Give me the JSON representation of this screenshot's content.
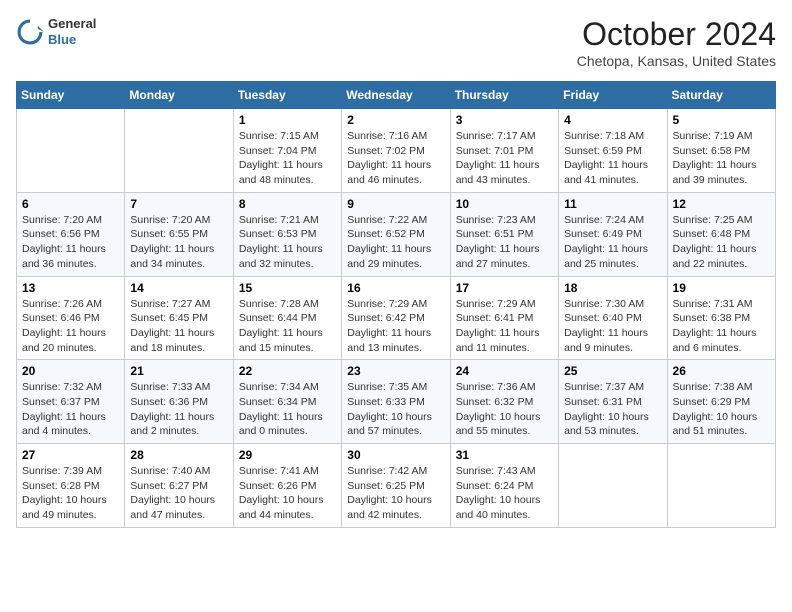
{
  "header": {
    "logo_line1": "General",
    "logo_line2": "Blue",
    "month_title": "October 2024",
    "location": "Chetopa, Kansas, United States"
  },
  "weekdays": [
    "Sunday",
    "Monday",
    "Tuesday",
    "Wednesday",
    "Thursday",
    "Friday",
    "Saturday"
  ],
  "weeks": [
    [
      {
        "day": "",
        "info": ""
      },
      {
        "day": "",
        "info": ""
      },
      {
        "day": "1",
        "info": "Sunrise: 7:15 AM\nSunset: 7:04 PM\nDaylight: 11 hours and 48 minutes."
      },
      {
        "day": "2",
        "info": "Sunrise: 7:16 AM\nSunset: 7:02 PM\nDaylight: 11 hours and 46 minutes."
      },
      {
        "day": "3",
        "info": "Sunrise: 7:17 AM\nSunset: 7:01 PM\nDaylight: 11 hours and 43 minutes."
      },
      {
        "day": "4",
        "info": "Sunrise: 7:18 AM\nSunset: 6:59 PM\nDaylight: 11 hours and 41 minutes."
      },
      {
        "day": "5",
        "info": "Sunrise: 7:19 AM\nSunset: 6:58 PM\nDaylight: 11 hours and 39 minutes."
      }
    ],
    [
      {
        "day": "6",
        "info": "Sunrise: 7:20 AM\nSunset: 6:56 PM\nDaylight: 11 hours and 36 minutes."
      },
      {
        "day": "7",
        "info": "Sunrise: 7:20 AM\nSunset: 6:55 PM\nDaylight: 11 hours and 34 minutes."
      },
      {
        "day": "8",
        "info": "Sunrise: 7:21 AM\nSunset: 6:53 PM\nDaylight: 11 hours and 32 minutes."
      },
      {
        "day": "9",
        "info": "Sunrise: 7:22 AM\nSunset: 6:52 PM\nDaylight: 11 hours and 29 minutes."
      },
      {
        "day": "10",
        "info": "Sunrise: 7:23 AM\nSunset: 6:51 PM\nDaylight: 11 hours and 27 minutes."
      },
      {
        "day": "11",
        "info": "Sunrise: 7:24 AM\nSunset: 6:49 PM\nDaylight: 11 hours and 25 minutes."
      },
      {
        "day": "12",
        "info": "Sunrise: 7:25 AM\nSunset: 6:48 PM\nDaylight: 11 hours and 22 minutes."
      }
    ],
    [
      {
        "day": "13",
        "info": "Sunrise: 7:26 AM\nSunset: 6:46 PM\nDaylight: 11 hours and 20 minutes."
      },
      {
        "day": "14",
        "info": "Sunrise: 7:27 AM\nSunset: 6:45 PM\nDaylight: 11 hours and 18 minutes."
      },
      {
        "day": "15",
        "info": "Sunrise: 7:28 AM\nSunset: 6:44 PM\nDaylight: 11 hours and 15 minutes."
      },
      {
        "day": "16",
        "info": "Sunrise: 7:29 AM\nSunset: 6:42 PM\nDaylight: 11 hours and 13 minutes."
      },
      {
        "day": "17",
        "info": "Sunrise: 7:29 AM\nSunset: 6:41 PM\nDaylight: 11 hours and 11 minutes."
      },
      {
        "day": "18",
        "info": "Sunrise: 7:30 AM\nSunset: 6:40 PM\nDaylight: 11 hours and 9 minutes."
      },
      {
        "day": "19",
        "info": "Sunrise: 7:31 AM\nSunset: 6:38 PM\nDaylight: 11 hours and 6 minutes."
      }
    ],
    [
      {
        "day": "20",
        "info": "Sunrise: 7:32 AM\nSunset: 6:37 PM\nDaylight: 11 hours and 4 minutes."
      },
      {
        "day": "21",
        "info": "Sunrise: 7:33 AM\nSunset: 6:36 PM\nDaylight: 11 hours and 2 minutes."
      },
      {
        "day": "22",
        "info": "Sunrise: 7:34 AM\nSunset: 6:34 PM\nDaylight: 11 hours and 0 minutes."
      },
      {
        "day": "23",
        "info": "Sunrise: 7:35 AM\nSunset: 6:33 PM\nDaylight: 10 hours and 57 minutes."
      },
      {
        "day": "24",
        "info": "Sunrise: 7:36 AM\nSunset: 6:32 PM\nDaylight: 10 hours and 55 minutes."
      },
      {
        "day": "25",
        "info": "Sunrise: 7:37 AM\nSunset: 6:31 PM\nDaylight: 10 hours and 53 minutes."
      },
      {
        "day": "26",
        "info": "Sunrise: 7:38 AM\nSunset: 6:29 PM\nDaylight: 10 hours and 51 minutes."
      }
    ],
    [
      {
        "day": "27",
        "info": "Sunrise: 7:39 AM\nSunset: 6:28 PM\nDaylight: 10 hours and 49 minutes."
      },
      {
        "day": "28",
        "info": "Sunrise: 7:40 AM\nSunset: 6:27 PM\nDaylight: 10 hours and 47 minutes."
      },
      {
        "day": "29",
        "info": "Sunrise: 7:41 AM\nSunset: 6:26 PM\nDaylight: 10 hours and 44 minutes."
      },
      {
        "day": "30",
        "info": "Sunrise: 7:42 AM\nSunset: 6:25 PM\nDaylight: 10 hours and 42 minutes."
      },
      {
        "day": "31",
        "info": "Sunrise: 7:43 AM\nSunset: 6:24 PM\nDaylight: 10 hours and 40 minutes."
      },
      {
        "day": "",
        "info": ""
      },
      {
        "day": "",
        "info": ""
      }
    ]
  ]
}
